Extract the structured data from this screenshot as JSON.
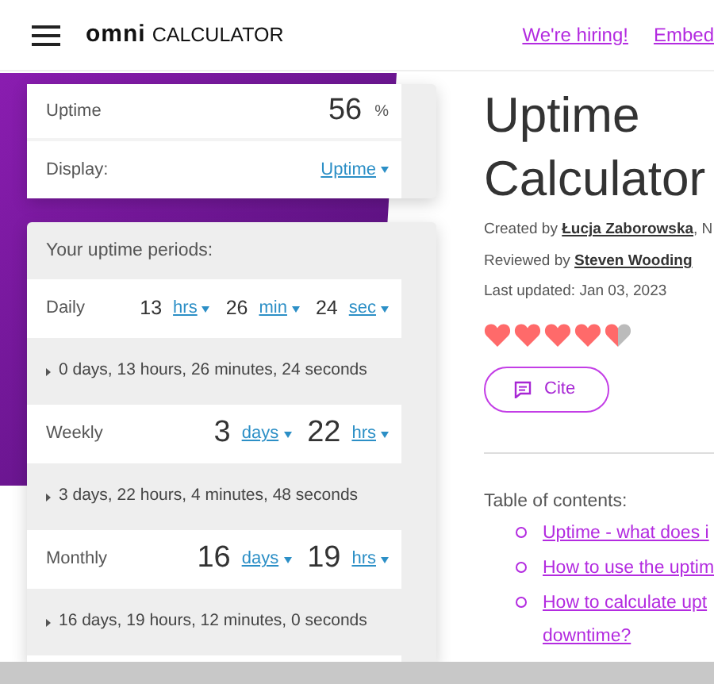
{
  "header": {
    "logo_mark": "omni",
    "logo_text": "CALCULATOR",
    "links": [
      "We're hiring!",
      "Embed"
    ]
  },
  "calculator": {
    "uptime": {
      "label": "Uptime",
      "value": "56",
      "unit": "%"
    },
    "display": {
      "label": "Display:",
      "value": "Uptime"
    },
    "periods": {
      "title": "Your uptime periods:",
      "rows": [
        {
          "label": "Daily",
          "fields": [
            {
              "value": "13",
              "unit": "hrs"
            },
            {
              "value": "26",
              "unit": "min"
            },
            {
              "value": "24",
              "unit": "sec"
            }
          ],
          "summary": "0 days, 13 hours, 26 minutes, 24 seconds"
        },
        {
          "label": "Weekly",
          "fields": [
            {
              "value": "3",
              "unit": "days"
            },
            {
              "value": "22",
              "unit": "hrs"
            }
          ],
          "summary": "3 days, 22 hours, 4 minutes, 48 seconds"
        },
        {
          "label": "Monthly",
          "fields": [
            {
              "value": "16",
              "unit": "days"
            },
            {
              "value": "19",
              "unit": "hrs"
            }
          ],
          "summary": "16 days, 19 hours, 12 minutes, 0 seconds"
        }
      ]
    }
  },
  "article": {
    "title": "Uptime Calculator",
    "created_by": {
      "prefix": "Created by",
      "author": "Łucja Zaborowska",
      "suffix": ", N"
    },
    "reviewed_by": {
      "prefix": "Reviewed by",
      "author": "Steven Wooding"
    },
    "updated": "Last updated: Jan 03, 2023",
    "stars": 4.5,
    "cite": "Cite",
    "toc": {
      "title": "Table of contents:",
      "items": [
        {
          "lines": [
            "Uptime - what does i"
          ]
        },
        {
          "lines": [
            "How to use the uptim"
          ]
        },
        {
          "lines": [
            "How to calculate upt",
            "downtime?"
          ]
        }
      ]
    }
  }
}
